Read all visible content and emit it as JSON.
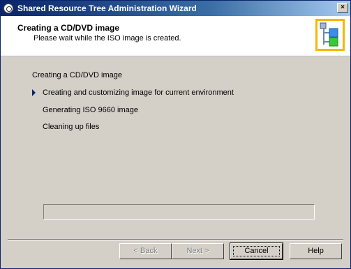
{
  "window": {
    "title": "Shared Resource Tree Administration Wizard",
    "close_glyph": "×"
  },
  "header": {
    "title": "Creating a CD/DVD image",
    "subtitle": "Please wait while the ISO image is created."
  },
  "steps": {
    "heading": "Creating a CD/DVD image",
    "items": [
      {
        "label": "Creating and customizing image for current environment",
        "current": true
      },
      {
        "label": "Generating ISO 9660 image",
        "current": false
      },
      {
        "label": "Cleaning up files",
        "current": false
      }
    ]
  },
  "progress": {
    "value": 0
  },
  "buttons": {
    "back": "< Back",
    "next": "Next >",
    "cancel": "Cancel",
    "help": "Help"
  },
  "colors": {
    "accent": "#0a246a",
    "logo_border": "#f4b800"
  }
}
